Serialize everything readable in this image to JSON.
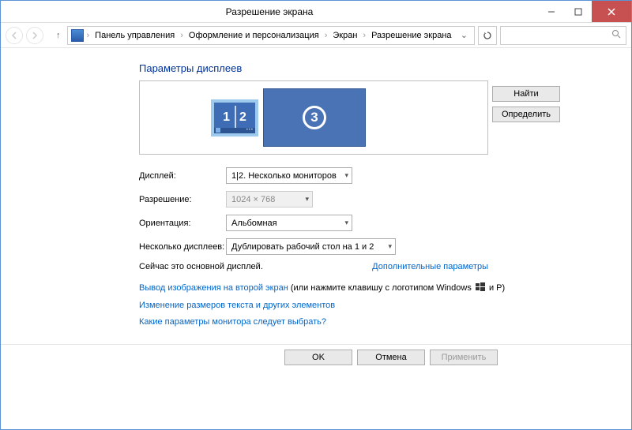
{
  "window": {
    "title": "Разрешение экрана"
  },
  "breadcrumb": {
    "root": "Панель управления",
    "b1": "Оформление и персонализация",
    "b2": "Экран",
    "b3": "Разрешение экрана"
  },
  "heading": "Параметры дисплеев",
  "monitors": {
    "m1": "1",
    "m2": "2",
    "m3": "3"
  },
  "buttons": {
    "find": "Найти",
    "identify": "Определить",
    "ok": "OK",
    "cancel": "Отмена",
    "apply": "Применить"
  },
  "labels": {
    "display": "Дисплей:",
    "resolution": "Разрешение:",
    "orientation": "Ориентация:",
    "multi": "Несколько дисплеев:"
  },
  "values": {
    "display": "1|2. Несколько мониторов",
    "resolution": "1024 × 768",
    "orientation": "Альбомная",
    "multi": "Дублировать рабочий стол на 1 и 2"
  },
  "status": {
    "primary": "Сейчас это основной дисплей.",
    "advanced": "Дополнительные параметры"
  },
  "links": {
    "project_pre": "Вывод изображения на второй экран",
    "project_post": " (или нажмите клавишу с логотипом Windows ",
    "project_tail": " и P)",
    "textsize": "Изменение размеров текста и других элементов",
    "which": "Какие параметры монитора следует выбрать?"
  }
}
